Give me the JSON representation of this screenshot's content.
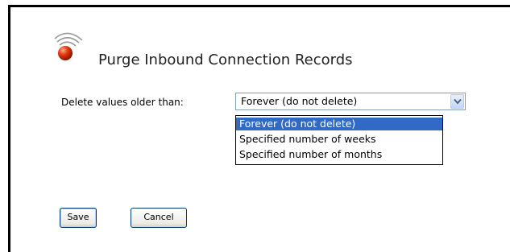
{
  "page": {
    "title": "Purge Inbound Connection Records"
  },
  "form": {
    "field_label": "Delete values older than:",
    "select": {
      "selected_value": "Forever (do not delete)",
      "options": [
        "Forever (do not delete)",
        "Specified number of weeks",
        "Specified number of months"
      ],
      "highlighted_option": "Forever (do not delete)"
    }
  },
  "buttons": {
    "save_label": "Save",
    "cancel_label": "Cancel"
  },
  "icons": {
    "logo": "signal-waves-icon",
    "dropdown": "chevron-down-icon"
  },
  "colors": {
    "highlight": "#316ac5",
    "logo_red": "#cc2200",
    "select_border": "#7f9db9",
    "button_border": "#003c74"
  }
}
